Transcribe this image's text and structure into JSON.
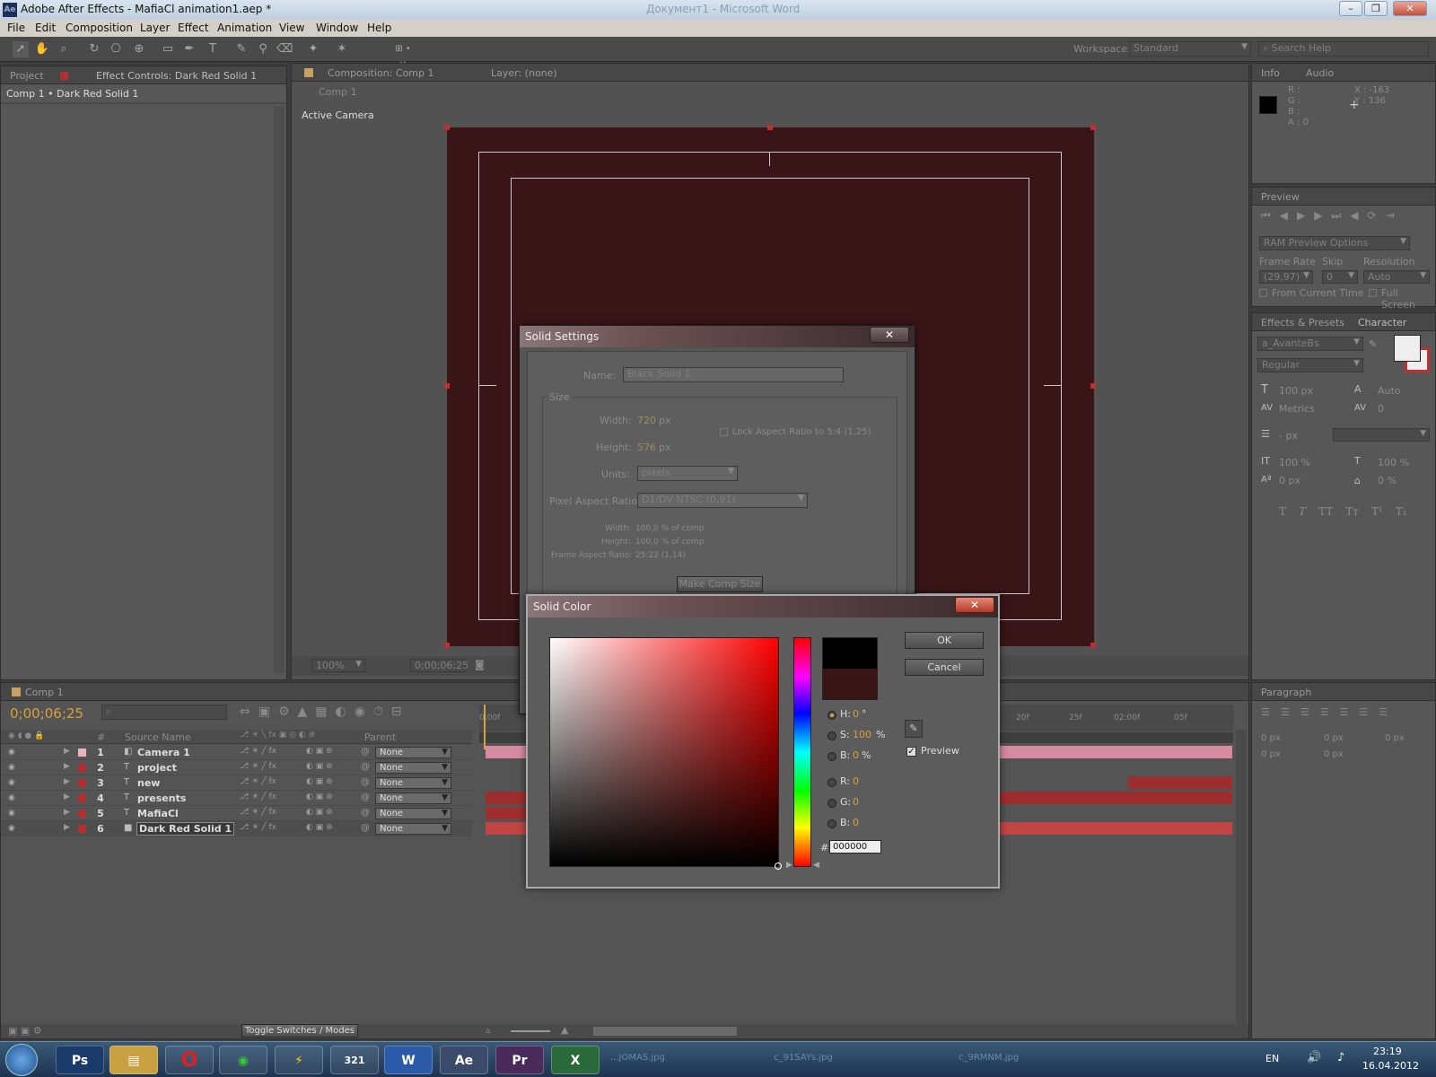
{
  "window": {
    "title": "Adobe After Effects - MafiaCl animation1.aep *",
    "ghost_title": "Документ1 - Microsoft Word",
    "app_icon": "Ae"
  },
  "menu": [
    "File",
    "Edit",
    "Composition",
    "Layer",
    "Effect",
    "Animation",
    "View",
    "Window",
    "Help"
  ],
  "toolbar": {
    "workspace_label": "Workspace:",
    "workspace_value": "Standard",
    "search_placeholder": "Search Help"
  },
  "left_panel": {
    "tab_project": "Project",
    "tab_effect_controls": "Effect Controls: Dark Red Solid 1",
    "breadcrumb": "Comp 1 • Dark Red Solid 1"
  },
  "comp_panel": {
    "tab_label": "Composition: Comp 1",
    "layer_tab": "Layer: (none)",
    "comp_name": "Comp 1",
    "camera_label": "Active Camera",
    "zoom": "100%",
    "timecode": "0;00;06;25",
    "frame_color": "#3a1518"
  },
  "info_panel": {
    "tab_info": "Info",
    "tab_audio": "Audio",
    "r": "R :",
    "g": "G :",
    "b": "B :",
    "a": "A : 0",
    "x": "X : -163",
    "y": "Y : 136"
  },
  "preview_panel": {
    "tab": "Preview",
    "ram_options": "RAM Preview Options",
    "frame_rate_label": "Frame Rate",
    "skip_label": "Skip",
    "resolution_label": "Resolution",
    "frame_rate": "(29,97)",
    "skip": "0",
    "resolution": "Auto",
    "from_current": "From Current Time",
    "full_screen": "Full Screen"
  },
  "character_panel": {
    "tab_effects": "Effects & Presets",
    "tab_character": "Character",
    "font": "a_AvanteBs",
    "style": "Regular",
    "size": "100 px",
    "leading": "Auto",
    "kerning": "Metrics",
    "tracking": "0",
    "stroke": "- px",
    "vscale": "100 %",
    "hscale": "100 %",
    "baseline": "0 px",
    "tsume": "0 %",
    "styles": [
      "T",
      "T",
      "TT",
      "Tт",
      "T¹",
      "T₁"
    ]
  },
  "paragraph_panel": {
    "tab": "Paragraph",
    "values": [
      "0 px",
      "0 px",
      "0 px",
      "0 px",
      "0 px"
    ]
  },
  "timeline": {
    "tab": "Comp 1",
    "timecode": "0;00;06;25",
    "col_num": "#",
    "col_source": "Source Name",
    "col_parent": "Parent",
    "ruler": [
      "0:00f",
      "20f",
      "25f",
      "02:00f",
      "05f"
    ],
    "toggle_label": "Toggle Switches / Modes",
    "layers": [
      {
        "num": "1",
        "name": "Camera 1",
        "color": "#e8b4c0",
        "type": "camera",
        "parent": "None"
      },
      {
        "num": "2",
        "name": "project",
        "color": "#b03030",
        "type": "T",
        "parent": "None"
      },
      {
        "num": "3",
        "name": "new",
        "color": "#b03030",
        "type": "T",
        "parent": "None"
      },
      {
        "num": "4",
        "name": "presents",
        "color": "#b03030",
        "type": "T",
        "parent": "None"
      },
      {
        "num": "5",
        "name": "MafiaCl",
        "color": "#b03030",
        "type": "T",
        "parent": "None"
      },
      {
        "num": "6",
        "name": "Dark Red Solid 1",
        "color": "#b03030",
        "type": "solid",
        "parent": "None"
      }
    ]
  },
  "solid_settings": {
    "title": "Solid Settings",
    "name_label": "Name:",
    "name_value": "Black Solid 1",
    "size_label": "Size",
    "width_label": "Width:",
    "width_value": "720",
    "width_unit": "px",
    "height_label": "Height:",
    "height_value": "576",
    "height_unit": "px",
    "lock_label": "Lock Aspect Ratio to 5:4 (1,25)",
    "units_label": "Units:",
    "units_value": "pixels",
    "par_label": "Pixel Aspect Ratio:",
    "par_value": "D1/DV NTSC (0,91)",
    "w_pct_label": "Width:",
    "w_pct": "100,0 % of comp",
    "h_pct_label": "Height:",
    "h_pct": "100,0 % of comp",
    "far_label": "Frame Aspect Ratio:",
    "far": "25:22 (1,14)",
    "make_comp": "Make Comp Size"
  },
  "solid_color": {
    "title": "Solid Color",
    "ok": "OK",
    "cancel": "Cancel",
    "h_label": "H:",
    "h": "0",
    "h_unit": "°",
    "s_label": "S:",
    "s": "100",
    "s_unit": "%",
    "b_label": "B:",
    "b": "0",
    "b_unit": "%",
    "r_label": "R:",
    "r": "0",
    "g_label": "G:",
    "g": "0",
    "b2_label": "B:",
    "b2": "0",
    "hash": "#",
    "hex": "000000",
    "preview_label": "Preview",
    "new_color": "#000000",
    "old_color": "#3a1518"
  },
  "taskbar": {
    "apps": [
      "Ps",
      "",
      "",
      "",
      "",
      "321",
      "W",
      "Ae",
      "Pr",
      "X"
    ],
    "ghost_items": [
      "...JOMAS.jpg",
      "c_91SAYs.jpg",
      "c_9RMNM.jpg"
    ],
    "lang": "EN",
    "time": "23:19",
    "date": "16.04.2012"
  }
}
